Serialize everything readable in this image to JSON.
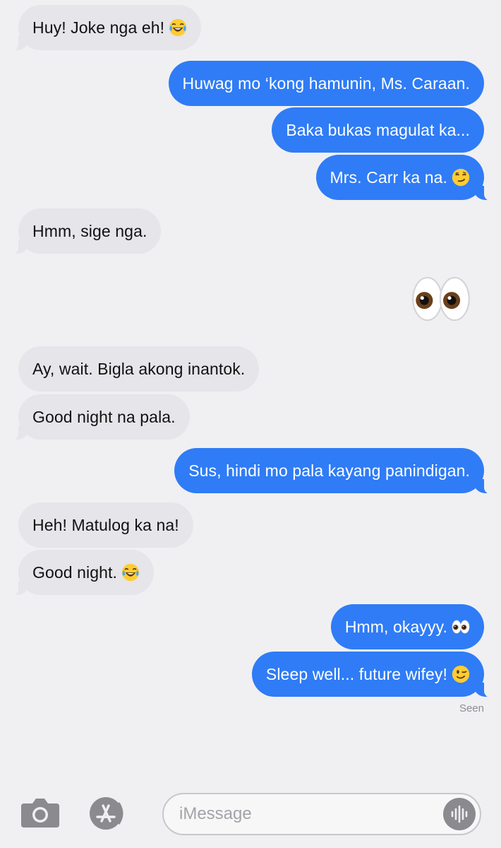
{
  "messages": [
    {
      "dir": "in",
      "text": "Huy! Joke nga eh!",
      "emoji": "joy"
    },
    {
      "dir": "out",
      "text": "Huwag mo ‘kong hamunin, Ms. Caraan."
    },
    {
      "dir": "out",
      "text": "Baka bukas magulat ka..."
    },
    {
      "dir": "out",
      "text": "Mrs. Carr ka na.",
      "emoji": "smirk"
    },
    {
      "dir": "in",
      "text": "Hmm, sige nga."
    },
    {
      "dir": "out",
      "emoji_only": "eyes"
    },
    {
      "dir": "in",
      "text": "Ay, wait. Bigla akong inantok."
    },
    {
      "dir": "in",
      "text": "Good night na pala."
    },
    {
      "dir": "out",
      "text": "Sus, hindi mo pala kayang panindigan."
    },
    {
      "dir": "in",
      "text": "Heh! Matulog ka na!"
    },
    {
      "dir": "in",
      "text": "Good night.",
      "emoji": "joy"
    },
    {
      "dir": "out",
      "text": "Hmm, okayyy.",
      "emoji": "eyes"
    },
    {
      "dir": "out",
      "text": "Sleep well... future wifey!",
      "emoji": "wink"
    }
  ],
  "m0": "Huy! Joke nga eh!",
  "m1": "Huwag mo ‘kong hamunin, Ms. Caraan.",
  "m2": "Baka bukas magulat ka...",
  "m3": "Mrs. Carr ka na.",
  "m4": "Hmm, sige nga.",
  "m6": "Ay, wait. Bigla akong inantok.",
  "m7": "Good night na pala.",
  "m8": "Sus, hindi mo pala kayang panindigan.",
  "m9": "Heh! Matulog ka na!",
  "m10": "Good night.",
  "m11": "Hmm, okayyy.",
  "m12": "Sleep well... future wifey!",
  "read_receipt": "Seen",
  "composer": {
    "placeholder": "iMessage",
    "icons": [
      "camera-icon",
      "app-store-icon",
      "audio-waveform-icon"
    ]
  },
  "colors": {
    "background": "#f0f0f2",
    "incoming_bubble": "#e5e5ea",
    "outgoing_bubble": "#2f7cf6",
    "incoming_text": "#111111",
    "outgoing_text": "#ffffff",
    "meta_text": "#8e8e93"
  }
}
